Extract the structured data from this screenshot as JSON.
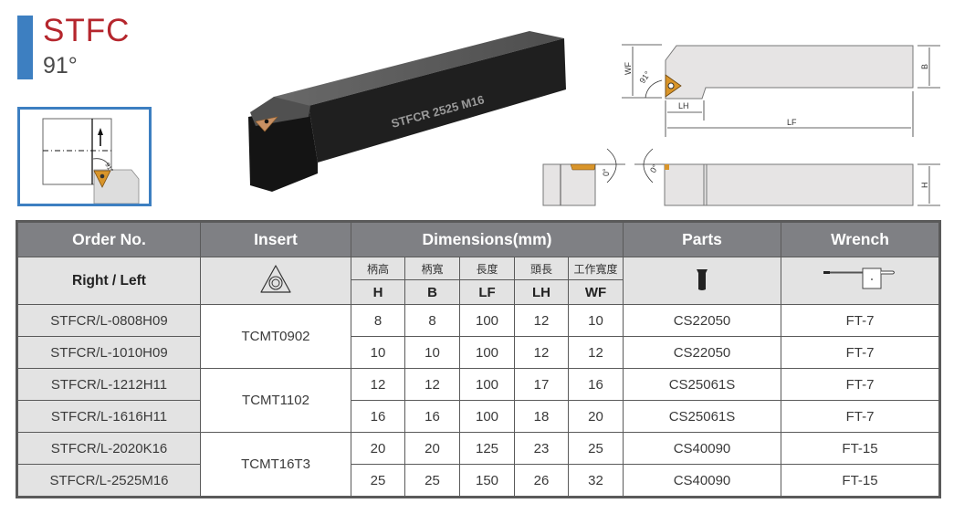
{
  "header": {
    "title": "STFC",
    "subtitle": "91°"
  },
  "product_image": {
    "engraving": "STFCR 2525 M16"
  },
  "diagram": {
    "top_view_labels": {
      "wf": "WF",
      "b": "B",
      "lh": "LH",
      "lf": "LF",
      "angle": "91°"
    },
    "side_view_labels": {
      "h": "H",
      "angle_left": "0°",
      "angle_right": "0°"
    },
    "orientation_angle": "91°"
  },
  "table": {
    "headers": {
      "order_no": "Order No.",
      "insert": "Insert",
      "dimensions": "Dimensions(mm)",
      "parts": "Parts",
      "wrench": "Wrench"
    },
    "subheaders": {
      "right_left": "Right / Left",
      "dims": [
        {
          "cjk": "柄高",
          "sym": "H"
        },
        {
          "cjk": "柄寬",
          "sym": "B"
        },
        {
          "cjk": "長度",
          "sym": "LF"
        },
        {
          "cjk": "頭長",
          "sym": "LH"
        },
        {
          "cjk": "工作寬度",
          "sym": "WF"
        }
      ],
      "insert_icon": "triangle-insert-icon",
      "parts_icon": "screw-icon",
      "wrench_icon": "torx-wrench-icon"
    },
    "rows": [
      {
        "order": "STFCR/L-0808H09",
        "insert": "TCMT0902",
        "H": "8",
        "B": "8",
        "LF": "100",
        "LH": "12",
        "WF": "10",
        "parts": "CS22050",
        "wrench": "FT-7"
      },
      {
        "order": "STFCR/L-1010H09",
        "insert": "TCMT0902",
        "H": "10",
        "B": "10",
        "LF": "100",
        "LH": "12",
        "WF": "12",
        "parts": "CS22050",
        "wrench": "FT-7"
      },
      {
        "order": "STFCR/L-1212H11",
        "insert": "TCMT1102",
        "H": "12",
        "B": "12",
        "LF": "100",
        "LH": "17",
        "WF": "16",
        "parts": "CS25061S",
        "wrench": "FT-7"
      },
      {
        "order": "STFCR/L-1616H11",
        "insert": "TCMT1102",
        "H": "16",
        "B": "16",
        "LF": "100",
        "LH": "18",
        "WF": "20",
        "parts": "CS25061S",
        "wrench": "FT-7"
      },
      {
        "order": "STFCR/L-2020K16",
        "insert": "TCMT16T3",
        "H": "20",
        "B": "20",
        "LF": "125",
        "LH": "23",
        "WF": "25",
        "parts": "CS40090",
        "wrench": "FT-15"
      },
      {
        "order": "STFCR/L-2525M16",
        "insert": "TCMT16T3",
        "H": "25",
        "B": "25",
        "LF": "150",
        "LH": "26",
        "WF": "32",
        "parts": "CS40090",
        "wrench": "FT-15"
      }
    ]
  },
  "colors": {
    "accent_blue": "#3d7fc1",
    "title_red": "#b5262d",
    "header_gray": "#7f8084",
    "subheader_gray": "#e3e3e3",
    "insert_gold": "#d9952a"
  }
}
